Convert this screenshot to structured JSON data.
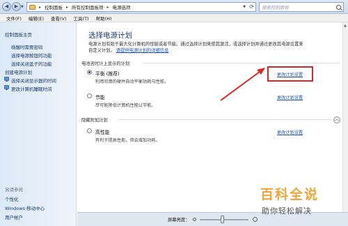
{
  "address": {
    "breadcrumbs": [
      "控制面板",
      "所有控制面板项",
      "电源选项"
    ],
    "search_placeholder": "搜索控制面板"
  },
  "menu": [
    "文件(F)",
    "编辑(E)",
    "查看(V)",
    "工具(T)",
    "帮助(H)"
  ],
  "sidebar": {
    "home": "控制面板主页",
    "links": [
      "唤醒时需要密码",
      "选择电源按钮的功能",
      "选择关闭盖子的功能",
      "创建电源计划",
      "选择关闭显示器的时间",
      "更改计算机睡眠时间"
    ],
    "see_also_title": "另请参阅",
    "see_also": [
      "个性化",
      "Windows 移动中心",
      "用户帐户"
    ]
  },
  "main": {
    "title": "选择电源计划",
    "desc_text": "电源计划有助于最大化计算机的性能或者节能。通过选择计划来使其激活，或选择计划并通过更改其电源设置来自定义计划。",
    "desc_link": "请提供电源计划的详细信息",
    "group_battery": "电池咨时计上显示的计划",
    "group_hidden": "隐藏附加计划",
    "plans": [
      {
        "name": "平衡 (推荐)",
        "desc": "利用可用的硬件自动平衡功耗与性能。",
        "link": "更改计划设置",
        "selected": true
      },
      {
        "name": "节能",
        "desc": "尽可能降低计算机性能以节能。",
        "link": "更改计划设置",
        "selected": false
      },
      {
        "name": "高性能",
        "desc": "有利于提高性能，但会增加功耗。",
        "link": "更改计划设置",
        "selected": false
      }
    ]
  },
  "bottom": {
    "brightness_label": "屏幕亮度：",
    "brightness_level": 0.45
  },
  "watermark": {
    "title": "百科全说",
    "subtitle": "助你轻松解决"
  },
  "colors": {
    "accent": "#1e3f7c",
    "highlight": "#e02424",
    "watermark": "#f2a53a"
  }
}
